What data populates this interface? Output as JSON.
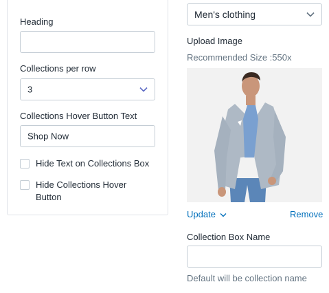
{
  "left_panel": {
    "heading_label": "Heading",
    "heading_value": "",
    "collections_per_row_label": "Collections per row",
    "collections_per_row_value": "3",
    "hover_button_text_label": "Collections Hover Button Text",
    "hover_button_text_value": "Shop Now",
    "checkbox_hide_text_label": "Hide Text on Collections Box",
    "checkbox_hide_button_label": "Hide Collections Hover Button",
    "checkbox_hide_text_checked": false,
    "checkbox_hide_button_checked": false
  },
  "right_panel": {
    "collection_select_value": "Men's clothing",
    "upload_image_label": "Upload Image",
    "recommended_size_text": "Recommended Size :550x",
    "update_link": "Update",
    "remove_link": "Remove",
    "collection_box_name_label": "Collection Box Name",
    "collection_box_name_value": "",
    "collection_box_name_help": "Default will be collection name"
  },
  "colors": {
    "link": "#006fbb",
    "border": "#c4cdd5",
    "text": "#212b36",
    "subdued": "#637381"
  },
  "icons": [
    "chevron-down-icon",
    "checkbox",
    "image-thumbnail"
  ]
}
